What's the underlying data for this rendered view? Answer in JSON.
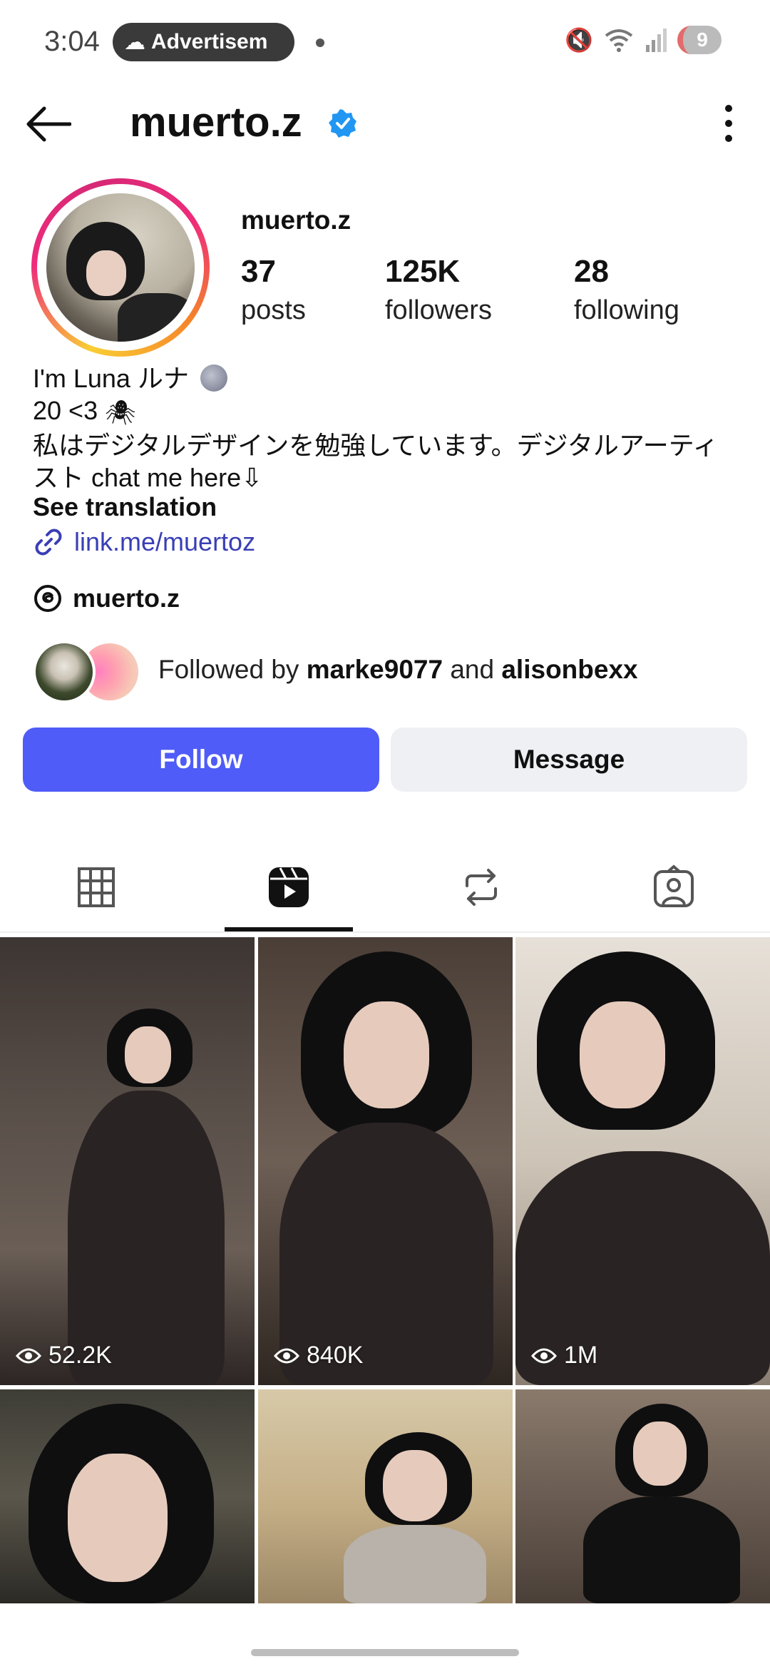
{
  "status_bar": {
    "time": "3:04",
    "ad_label": "Advertisem",
    "battery": "9"
  },
  "header": {
    "title": "muerto.z"
  },
  "profile": {
    "username": "muerto.z",
    "stats": {
      "posts_count": "37",
      "posts_label": "posts",
      "followers_count": "125K",
      "followers_label": "followers",
      "following_count": "28",
      "following_label": "following"
    },
    "bio": {
      "line1": "I'm Luna ルナ",
      "line2": "20 <3",
      "line3": "私はデジタルデザインを勉強しています。デジタルアーティ",
      "line4": "スト chat me here⇩"
    },
    "see_translation": "See translation",
    "link": "link.me/muertoz",
    "threads_handle": "muerto.z",
    "followed_by": {
      "prefix": "Followed by ",
      "user1": "marke9077",
      "joiner": " and ",
      "user2": "alisonbexx"
    }
  },
  "actions": {
    "follow_label": "Follow",
    "message_label": "Message"
  },
  "tabs": [
    {
      "name": "posts-grid",
      "icon": "grid-icon"
    },
    {
      "name": "reels",
      "icon": "reels-icon",
      "active": true
    },
    {
      "name": "reposts",
      "icon": "repost-icon"
    },
    {
      "name": "tagged",
      "icon": "tagged-person-icon"
    }
  ],
  "reels": [
    {
      "views": "52.2K"
    },
    {
      "views": "840K"
    },
    {
      "views": "1M"
    },
    {
      "views": ""
    },
    {
      "views": ""
    },
    {
      "views": ""
    }
  ],
  "colors": {
    "follow_button": "#4f5cf7",
    "message_button": "#eff0f3",
    "link": "#3a3fb5",
    "verified": "#2196f3"
  }
}
